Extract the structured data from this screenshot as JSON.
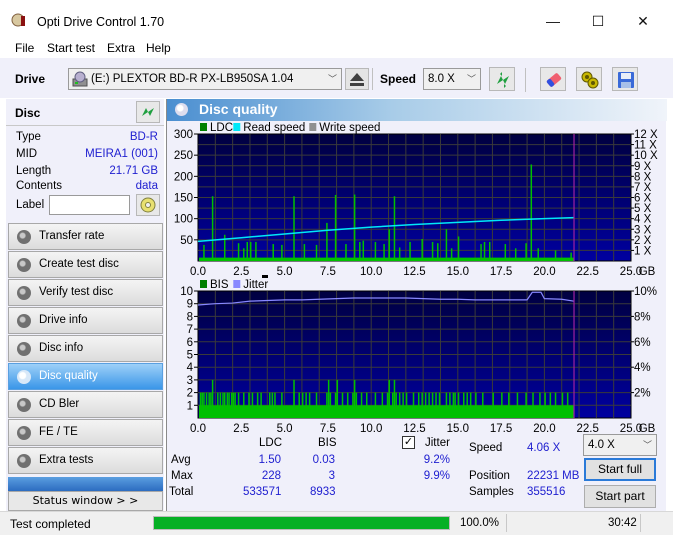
{
  "window": {
    "title": "Opti Drive Control 1.70",
    "minimize": "—",
    "maximize": "☐",
    "close": "✕"
  },
  "menu": [
    "File",
    "Start test",
    "Extra",
    "Help"
  ],
  "toolbar": {
    "drive_label": "Drive",
    "drive_value": "(E:)  PLEXTOR BD-R  PX-LB950SA 1.04",
    "speed_label": "Speed",
    "speed_value": "8.0 X",
    "icons": [
      "refresh-icon",
      "eraser-icon",
      "settings-icon",
      "save-icon"
    ]
  },
  "disc": {
    "header": "Disc",
    "rows": [
      {
        "key": "Type",
        "value": "BD-R"
      },
      {
        "key": "MID",
        "value": "MEIRA1 (001)"
      },
      {
        "key": "Length",
        "value": "21.71 GB"
      },
      {
        "key": "Contents",
        "value": "data"
      }
    ],
    "label_key": "Label",
    "label_value": ""
  },
  "nav": [
    {
      "label": "Transfer rate",
      "active": false
    },
    {
      "label": "Create test disc",
      "active": false
    },
    {
      "label": "Verify test disc",
      "active": false
    },
    {
      "label": "Drive info",
      "active": false
    },
    {
      "label": "Disc info",
      "active": false
    },
    {
      "label": "Disc quality",
      "active": true
    },
    {
      "label": "CD Bler",
      "active": false
    },
    {
      "label": "FE / TE",
      "active": false
    },
    {
      "label": "Extra tests",
      "active": false
    }
  ],
  "status_window_button": "Status window > >",
  "panel": {
    "title": "Disc quality"
  },
  "colors": {
    "ldc": "#00c000",
    "read_speed": "#00e8f8",
    "write_speed": "#909090",
    "bis": "#00c000",
    "jitter": "#8888ff",
    "end_marker": "#a020a0"
  },
  "chart_data": [
    {
      "type": "bar",
      "title": "",
      "legend": [
        "LDC",
        "Read speed",
        "Write speed"
      ],
      "legend_position": "top-left",
      "xlabel": "GB",
      "x_ticks": [
        "0.0",
        "2.5",
        "5.0",
        "7.5",
        "10.0",
        "12.5",
        "15.0",
        "17.5",
        "20.0",
        "22.5",
        "25.0"
      ],
      "xlim": [
        0,
        25
      ],
      "y_left_ticks": [
        "50",
        "100",
        "150",
        "200",
        "250",
        "300"
      ],
      "ylim_left": [
        0,
        300
      ],
      "y_right_ticks": [
        "1 X",
        "2 X",
        "3 X",
        "4 X",
        "5 X",
        "6 X",
        "7 X",
        "8 X",
        "9 X",
        "10 X",
        "11 X",
        "12 X"
      ],
      "ylim_right": [
        0,
        12
      ],
      "grid": true,
      "end_position_gb": 21.71,
      "ldc_baseline": 8,
      "ldc_spikes": [
        {
          "x": 0.3,
          "y": 38
        },
        {
          "x": 0.8,
          "y": 153
        },
        {
          "x": 1.5,
          "y": 62
        },
        {
          "x": 2.3,
          "y": 42
        },
        {
          "x": 2.6,
          "y": 30
        },
        {
          "x": 2.8,
          "y": 45
        },
        {
          "x": 3.0,
          "y": 45
        },
        {
          "x": 3.3,
          "y": 45
        },
        {
          "x": 4.3,
          "y": 40
        },
        {
          "x": 4.8,
          "y": 38
        },
        {
          "x": 5.5,
          "y": 153
        },
        {
          "x": 6.1,
          "y": 40
        },
        {
          "x": 6.8,
          "y": 38
        },
        {
          "x": 7.4,
          "y": 90
        },
        {
          "x": 7.9,
          "y": 156
        },
        {
          "x": 8.5,
          "y": 40
        },
        {
          "x": 9.0,
          "y": 157
        },
        {
          "x": 9.3,
          "y": 45
        },
        {
          "x": 9.5,
          "y": 48
        },
        {
          "x": 10.2,
          "y": 45
        },
        {
          "x": 10.7,
          "y": 40
        },
        {
          "x": 11.0,
          "y": 75
        },
        {
          "x": 11.3,
          "y": 153
        },
        {
          "x": 11.6,
          "y": 32
        },
        {
          "x": 12.2,
          "y": 45
        },
        {
          "x": 12.9,
          "y": 52
        },
        {
          "x": 13.5,
          "y": 45
        },
        {
          "x": 13.8,
          "y": 42
        },
        {
          "x": 14.3,
          "y": 75
        },
        {
          "x": 14.6,
          "y": 30
        },
        {
          "x": 15.0,
          "y": 58
        },
        {
          "x": 16.3,
          "y": 40
        },
        {
          "x": 16.5,
          "y": 45
        },
        {
          "x": 16.8,
          "y": 45
        },
        {
          "x": 17.7,
          "y": 40
        },
        {
          "x": 18.3,
          "y": 30
        },
        {
          "x": 18.9,
          "y": 42
        },
        {
          "x": 19.2,
          "y": 228
        },
        {
          "x": 19.6,
          "y": 30
        },
        {
          "x": 20.6,
          "y": 25
        },
        {
          "x": 21.5,
          "y": 20
        }
      ],
      "read_speed": [
        {
          "x": 0.0,
          "y": 1.85
        },
        {
          "x": 2.5,
          "y": 2.2
        },
        {
          "x": 5.0,
          "y": 2.55
        },
        {
          "x": 7.5,
          "y": 2.9
        },
        {
          "x": 10.0,
          "y": 3.2
        },
        {
          "x": 12.5,
          "y": 3.45
        },
        {
          "x": 15.0,
          "y": 3.65
        },
        {
          "x": 17.5,
          "y": 3.85
        },
        {
          "x": 20.0,
          "y": 4.0
        },
        {
          "x": 21.71,
          "y": 4.1
        }
      ]
    },
    {
      "type": "bar",
      "title": "",
      "legend": [
        "BIS",
        "Jitter"
      ],
      "legend_position": "top-left",
      "xlabel": "GB",
      "x_ticks": [
        "0.0",
        "2.5",
        "5.0",
        "7.5",
        "10.0",
        "12.5",
        "15.0",
        "17.5",
        "20.0",
        "22.5",
        "25.0"
      ],
      "xlim": [
        0,
        25
      ],
      "y_left_ticks": [
        "1",
        "2",
        "3",
        "4",
        "5",
        "6",
        "7",
        "8",
        "9",
        "10"
      ],
      "ylim_left": [
        0,
        10
      ],
      "y_right_ticks": [
        "2%",
        "4%",
        "6%",
        "8%",
        "10%"
      ],
      "ylim_right": [
        0,
        10
      ],
      "grid": true,
      "end_position_gb": 21.71,
      "bis_baseline": 1,
      "bis_twos": [
        0.1,
        0.2,
        0.3,
        0.45,
        0.6,
        0.7,
        1.1,
        1.25,
        1.4,
        1.5,
        1.65,
        1.75,
        1.9,
        2.0,
        2.1,
        2.3,
        2.6,
        2.9,
        3.1,
        3.4,
        3.6,
        4.1,
        4.25,
        4.4,
        4.8,
        5.5,
        5.8,
        6.0,
        6.2,
        6.4,
        6.8,
        7.4,
        7.6,
        7.9,
        8.3,
        8.6,
        8.9,
        9.1,
        9.4,
        9.7,
        10.2,
        10.6,
        10.9,
        11.0,
        11.2,
        11.4,
        11.6,
        11.8,
        12.0,
        12.4,
        12.7,
        12.9,
        13.1,
        13.3,
        13.5,
        13.7,
        13.9,
        14.3,
        14.5,
        14.7,
        14.8,
        15.0,
        15.3,
        15.5,
        15.7,
        16.0,
        16.4,
        17.0,
        17.5,
        17.9,
        18.4,
        18.9,
        19.3,
        19.7,
        20.0,
        20.3,
        20.6,
        21.0,
        21.3
      ],
      "bis_threes": [
        0.8,
        5.5,
        7.5,
        8.0,
        9.0,
        11.0,
        11.3
      ],
      "jitter": [
        {
          "x": 0.0,
          "y": 8.9
        },
        {
          "x": 1.0,
          "y": 9.0
        },
        {
          "x": 2.0,
          "y": 9.05
        },
        {
          "x": 3.0,
          "y": 9.2
        },
        {
          "x": 4.0,
          "y": 9.25
        },
        {
          "x": 5.0,
          "y": 9.3
        },
        {
          "x": 6.0,
          "y": 9.3
        },
        {
          "x": 7.0,
          "y": 9.35
        },
        {
          "x": 8.0,
          "y": 9.4
        },
        {
          "x": 9.0,
          "y": 9.45
        },
        {
          "x": 10.0,
          "y": 9.45
        },
        {
          "x": 11.0,
          "y": 9.45
        },
        {
          "x": 12.0,
          "y": 9.45
        },
        {
          "x": 13.0,
          "y": 9.4
        },
        {
          "x": 14.0,
          "y": 9.35
        },
        {
          "x": 15.0,
          "y": 9.35
        },
        {
          "x": 16.0,
          "y": 9.3
        },
        {
          "x": 17.0,
          "y": 9.3
        },
        {
          "x": 18.0,
          "y": 9.3
        },
        {
          "x": 19.0,
          "y": 9.3
        },
        {
          "x": 19.3,
          "y": 9.9
        },
        {
          "x": 19.8,
          "y": 9.9
        },
        {
          "x": 20.0,
          "y": 9.4
        },
        {
          "x": 21.0,
          "y": 9.35
        },
        {
          "x": 21.71,
          "y": 9.2
        }
      ]
    }
  ],
  "stats": {
    "col_ldc": "LDC",
    "col_bis": "BIS",
    "jitter_label": "Jitter",
    "jitter_checked": true,
    "rows": [
      {
        "label": "Avg",
        "ldc": "1.50",
        "bis": "0.03",
        "jitter": "9.2%"
      },
      {
        "label": "Max",
        "ldc": "228",
        "bis": "3",
        "jitter": "9.9%"
      },
      {
        "label": "Total",
        "ldc": "533571",
        "bis": "8933",
        "jitter": ""
      }
    ],
    "speed_label": "Speed",
    "speed_value": "4.06 X",
    "position_label": "Position",
    "position_value": "22231 MB",
    "samples_label": "Samples",
    "samples_value": "355516",
    "speed_select": "4.0 X",
    "start_full": "Start full",
    "start_part": "Start part"
  },
  "statusbar": {
    "text": "Test completed",
    "progress_percent": 100,
    "progress_text": "100.0%",
    "time": "30:42"
  }
}
